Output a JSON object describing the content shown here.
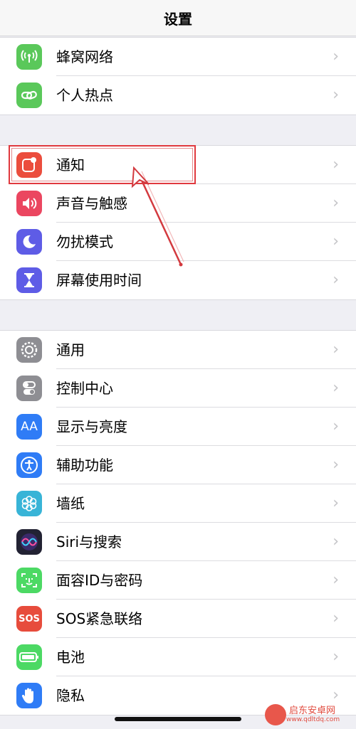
{
  "navbar": {
    "title": "设置"
  },
  "groups": [
    {
      "items": [
        {
          "label": "蜂窝网络",
          "icon": "cellular-icon",
          "color": "#5ac85a"
        },
        {
          "label": "个人热点",
          "icon": "hotspot-icon",
          "color": "#5ac85a"
        }
      ]
    },
    {
      "items": [
        {
          "label": "通知",
          "icon": "notifications-icon",
          "color": "#eb4d3d"
        },
        {
          "label": "声音与触感",
          "icon": "sound-icon",
          "color": "#eb4660"
        },
        {
          "label": "勿扰模式",
          "icon": "moon-icon",
          "color": "#5e5ce6"
        },
        {
          "label": "屏幕使用时间",
          "icon": "hourglass-icon",
          "color": "#5e5ce6"
        }
      ]
    },
    {
      "items": [
        {
          "label": "通用",
          "icon": "gear-icon",
          "color": "#8e8e93"
        },
        {
          "label": "控制中心",
          "icon": "toggles-icon",
          "color": "#8e8e93"
        },
        {
          "label": "显示与亮度",
          "icon": "display-icon",
          "color": "#2f7cf6"
        },
        {
          "label": "辅助功能",
          "icon": "accessibility-icon",
          "color": "#2f7cf6"
        },
        {
          "label": "墙纸",
          "icon": "wallpaper-icon",
          "color": "#38b4d7"
        },
        {
          "label": "Siri与搜索",
          "icon": "siri-icon",
          "color": "#222233"
        },
        {
          "label": "面容ID与密码",
          "icon": "faceid-icon",
          "color": "#4cd964"
        },
        {
          "label": "SOS紧急联络",
          "icon": "sos-icon",
          "color": "#e74c3c"
        },
        {
          "label": "电池",
          "icon": "battery-icon",
          "color": "#4cd964"
        },
        {
          "label": "隐私",
          "icon": "hand-icon",
          "color": "#2f7cf6"
        }
      ]
    }
  ],
  "chevron": "›",
  "watermark": {
    "text": "启东安卓网",
    "url": "www.qdltdq.com"
  },
  "sos_text": "SOS",
  "aa_text": "AA"
}
